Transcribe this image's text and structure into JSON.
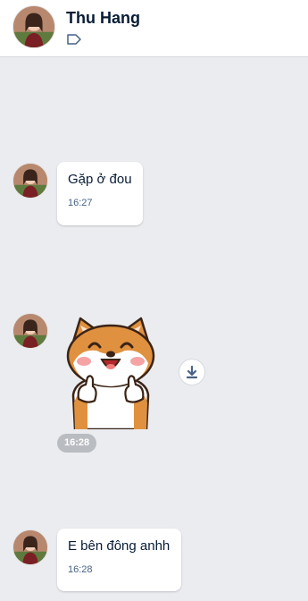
{
  "header": {
    "contact_name": "Thu Hang",
    "avatar_icon": "contact-avatar",
    "tag_icon": "tag-icon"
  },
  "messages": [
    {
      "type": "text",
      "text": "Gặp ở đou",
      "time": "16:27"
    },
    {
      "type": "sticker",
      "sticker": "shiba-dog-thumbs-up",
      "time": "16:28",
      "action_icon": "download-icon"
    },
    {
      "type": "text",
      "text": "E bên đông anhh",
      "time": "16:28"
    }
  ],
  "colors": {
    "background": "#ebecf0",
    "bubble": "#ffffff",
    "name_text": "#081c36",
    "time_text": "#476285",
    "time_pill": "#b9bcc1"
  }
}
